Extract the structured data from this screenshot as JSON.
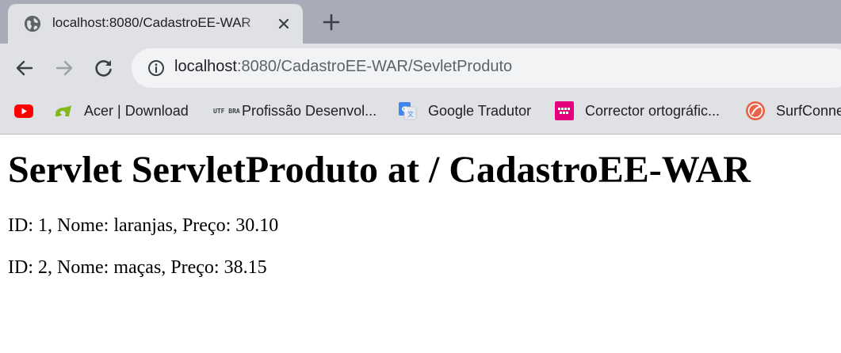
{
  "tab": {
    "title": "localhost:8080/CadastroEE-WAR"
  },
  "toolbar": {
    "url_host": "localhost",
    "url_rest": ":8080/CadastroEE-WAR/SevletProduto"
  },
  "bookmarks": [
    {
      "label": "",
      "icon": "youtube-icon",
      "color": "#ff0000"
    },
    {
      "label": "Acer | Download",
      "icon": "acer-icon",
      "color": "#83b81a"
    },
    {
      "label": "Profissão Desenvol...",
      "icon": "code-brand-icon",
      "icon_text": "UTF BRA"
    },
    {
      "label": "Google Tradutor",
      "icon": "google-translate-icon",
      "color": "#4285f4"
    },
    {
      "label": "Corrector ortográfic...",
      "icon": "corrector-icon",
      "color": "#e6007e"
    },
    {
      "label": "SurfConne",
      "icon": "surfconnect-icon",
      "color": "#e8634a"
    }
  ],
  "page": {
    "heading": "Servlet ServletProduto at / CadastroEE-WAR",
    "rows": [
      "ID: 1, Nome: laranjas, Preço: 30.10",
      "ID: 2, Nome: maças, Preço: 38.15"
    ]
  }
}
